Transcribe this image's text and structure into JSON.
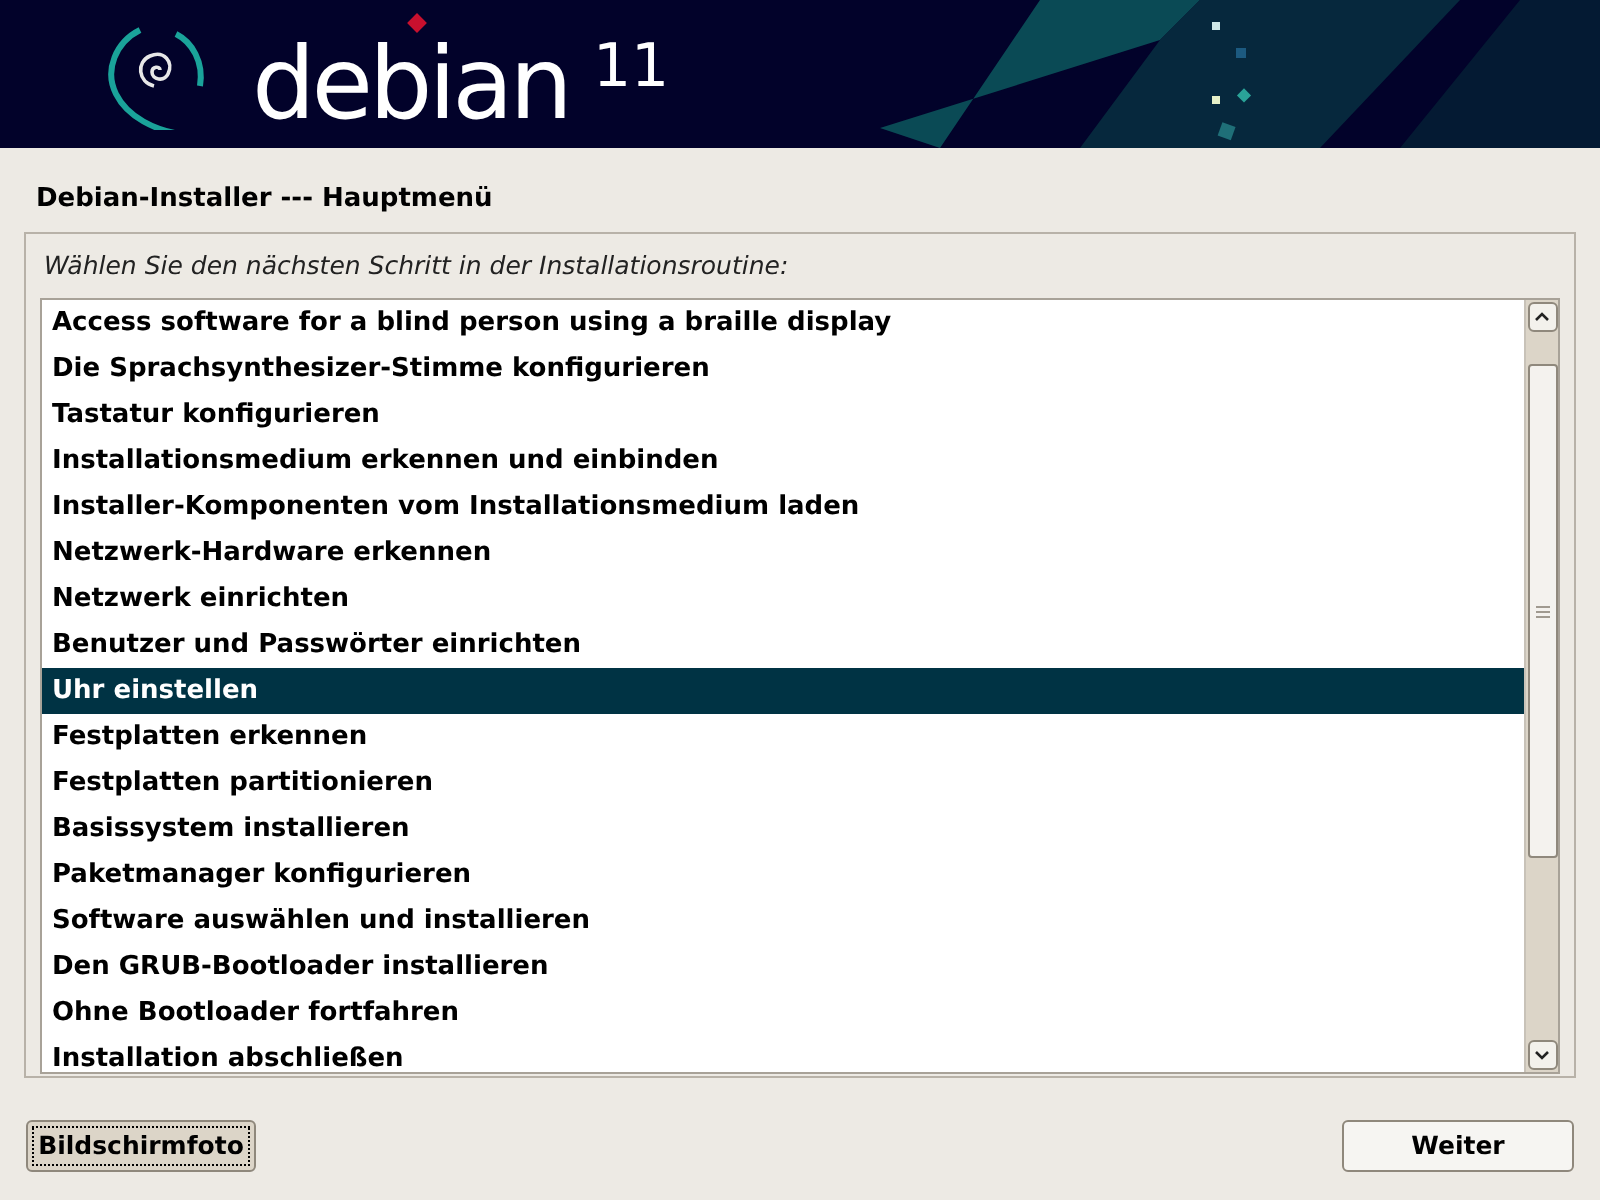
{
  "banner": {
    "logo_text": "debian",
    "version": "11"
  },
  "title": "Debian-Installer --- Hauptmenü",
  "prompt": "Wählen Sie den nächsten Schritt in der Installationsroutine:",
  "menu_items": [
    {
      "label": "Access software for a blind person using a braille display",
      "selected": false
    },
    {
      "label": "Die Sprachsynthesizer-Stimme konfigurieren",
      "selected": false
    },
    {
      "label": "Tastatur konfigurieren",
      "selected": false
    },
    {
      "label": "Installationsmedium erkennen und einbinden",
      "selected": false
    },
    {
      "label": "Installer-Komponenten vom Installationsmedium laden",
      "selected": false
    },
    {
      "label": "Netzwerk-Hardware erkennen",
      "selected": false
    },
    {
      "label": "Netzwerk einrichten",
      "selected": false
    },
    {
      "label": "Benutzer und Passwörter einrichten",
      "selected": false
    },
    {
      "label": "Uhr einstellen",
      "selected": true
    },
    {
      "label": "Festplatten erkennen",
      "selected": false
    },
    {
      "label": "Festplatten partitionieren",
      "selected": false
    },
    {
      "label": "Basissystem installieren",
      "selected": false
    },
    {
      "label": "Paketmanager konfigurieren",
      "selected": false
    },
    {
      "label": "Software auswählen und installieren",
      "selected": false
    },
    {
      "label": "Den GRUB-Bootloader installieren",
      "selected": false
    },
    {
      "label": "Ohne Bootloader fortfahren",
      "selected": false
    },
    {
      "label": "Installation abschließen",
      "selected": false
    }
  ],
  "buttons": [
    {
      "label": "Bildschirmfoto",
      "focused": true
    },
    {
      "label": "Weiter",
      "focused": false
    }
  ]
}
